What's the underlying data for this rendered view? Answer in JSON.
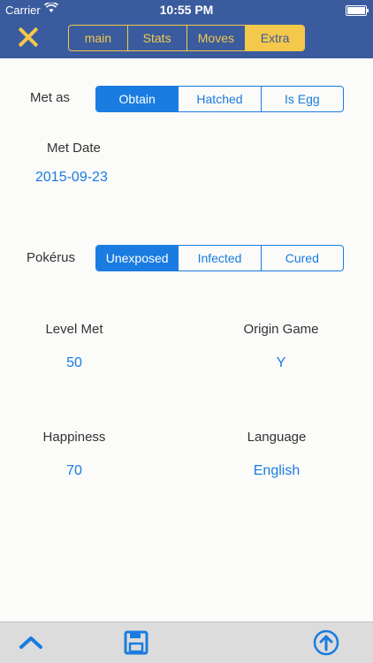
{
  "status_bar": {
    "carrier": "Carrier",
    "time": "10:55 PM"
  },
  "nav": {
    "tabs": [
      {
        "label": "main",
        "active": false
      },
      {
        "label": "Stats",
        "active": false
      },
      {
        "label": "Moves",
        "active": false
      },
      {
        "label": "Extra",
        "active": true
      }
    ]
  },
  "met_as": {
    "label": "Met as",
    "options": [
      "Obtain",
      "Hatched",
      "Is Egg"
    ],
    "selected": "Obtain"
  },
  "met_date": {
    "label": "Met Date",
    "value": "2015-09-23"
  },
  "pokerus": {
    "label": "Pokérus",
    "options": [
      "Unexposed",
      "Infected",
      "Cured"
    ],
    "selected": "Unexposed"
  },
  "level_met": {
    "label": "Level Met",
    "value": "50"
  },
  "origin_game": {
    "label": "Origin Game",
    "value": "Y"
  },
  "happiness": {
    "label": "Happiness",
    "value": "70"
  },
  "language": {
    "label": "Language",
    "value": "English"
  },
  "toolbar": {
    "icons": [
      "chevron-up-icon",
      "save-icon",
      "upload-icon"
    ]
  },
  "colors": {
    "nav_bg": "#3a5b9e",
    "accent": "#f4c84a",
    "link": "#1a7ce0"
  }
}
